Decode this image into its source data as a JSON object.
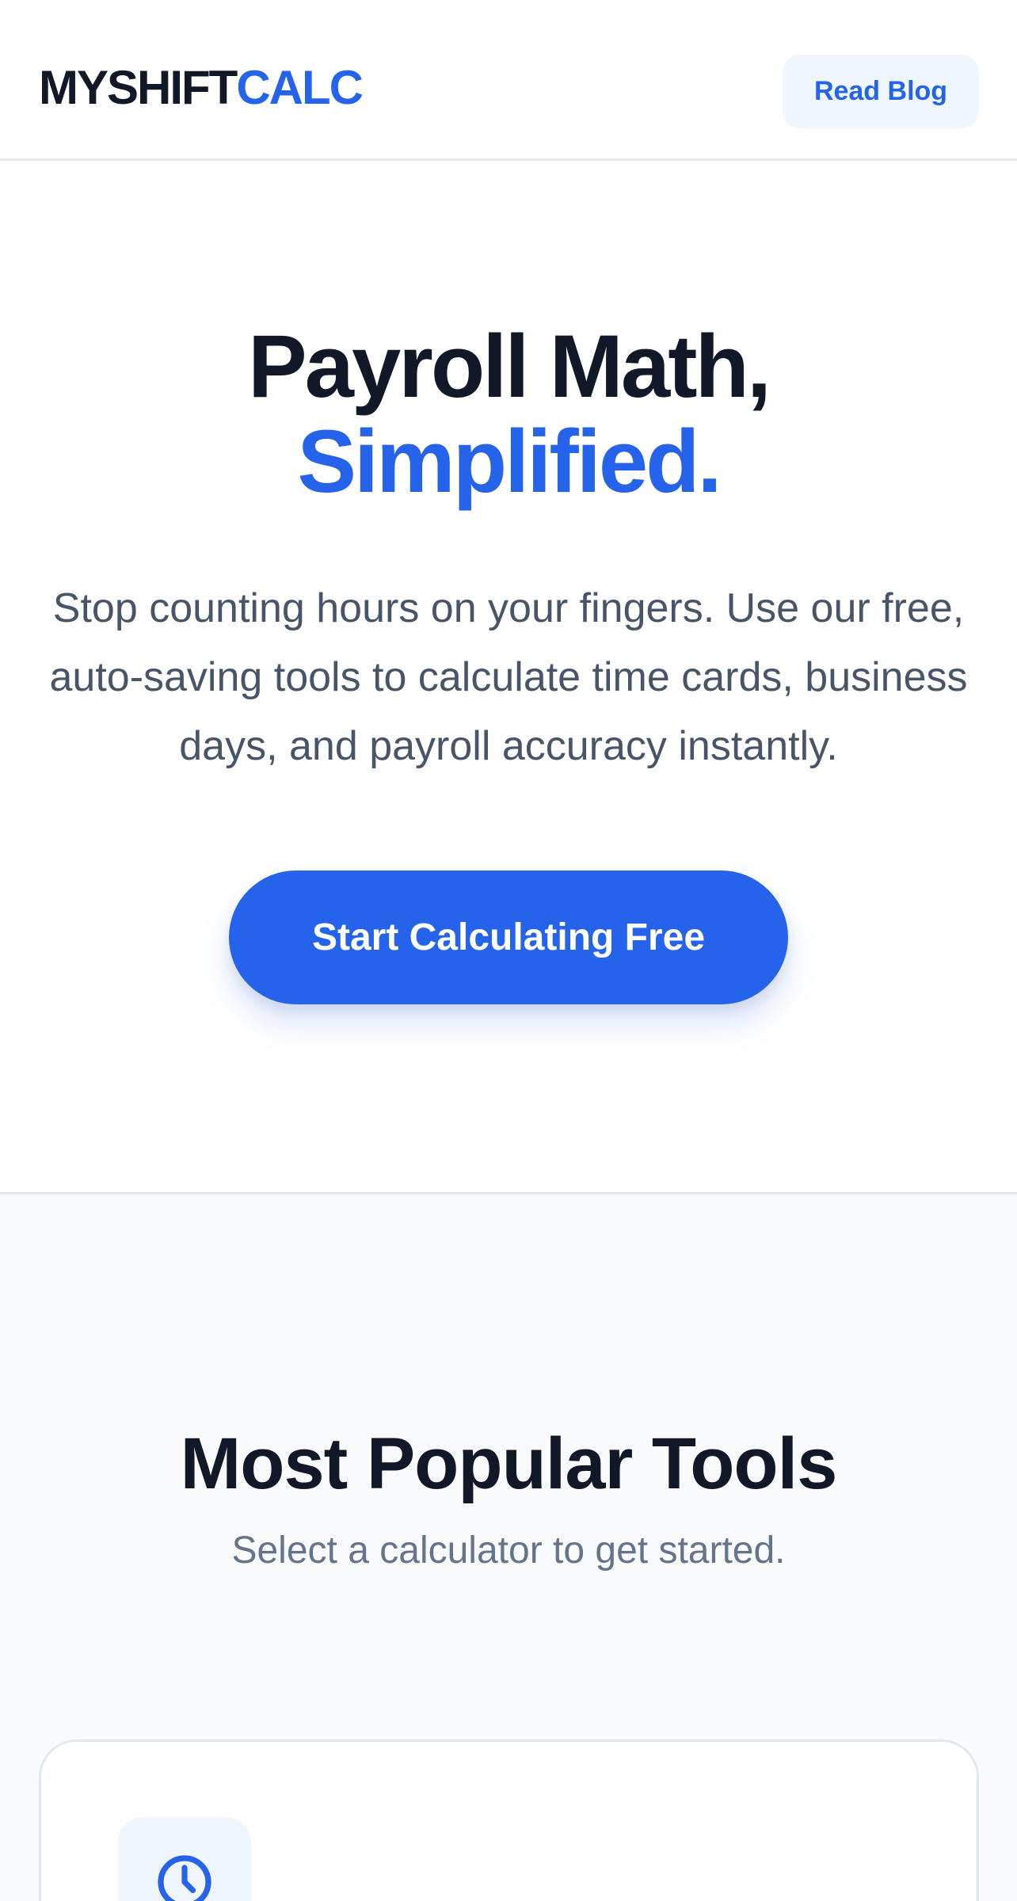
{
  "header": {
    "logo_part1": "MYSHIFT",
    "logo_part2": "CALC",
    "read_blog_label": "Read Blog"
  },
  "hero": {
    "title_line1": "Payroll Math,",
    "title_line2": "Simplified.",
    "subtitle": "Stop counting hours on your fingers. Use our free, auto-saving tools to calculate time cards, business days, and payroll accuracy instantly.",
    "cta_label": "Start Calculating Free"
  },
  "tools": {
    "title": "Most Popular Tools",
    "subtitle": "Select a calculator to get started.",
    "cards": [
      {
        "icon": "clock-icon"
      }
    ]
  },
  "colors": {
    "brand_blue": "#2563eb",
    "heading_dark": "#111827",
    "body_text": "#475569",
    "muted_text": "#64748b",
    "section_bg": "#f8fafc",
    "icon_bg": "#eff6ff"
  }
}
